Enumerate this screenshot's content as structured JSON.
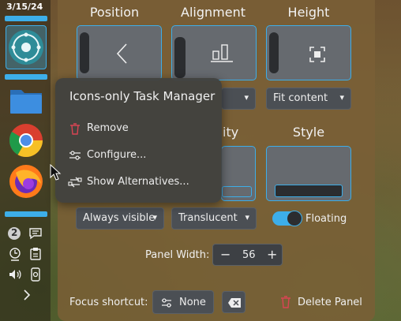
{
  "left_panel": {
    "date": "3/15/24",
    "notification_count": "2"
  },
  "config": {
    "position_title": "Position",
    "alignment_title": "Alignment",
    "height_title": "Height",
    "visibility_title_partial": "ity",
    "style_title": "Style",
    "height_dropdown": "Fit content",
    "visibility_dropdown": "Always visible",
    "opacity_dropdown": "Translucent",
    "floating_label": "Floating",
    "floating_on": true,
    "panel_width_label": "Panel Width:",
    "panel_width_value": "56",
    "focus_shortcut_label": "Focus shortcut:",
    "shortcut_value": "None",
    "delete_panel_label": "Delete Panel"
  },
  "context_menu": {
    "title": "Icons-only Task Manager",
    "items": [
      {
        "label": "Remove",
        "icon": "trash-icon"
      },
      {
        "label": "Configure...",
        "icon": "configure-icon"
      },
      {
        "label": "Show Alternatives...",
        "icon": "alternatives-icon"
      }
    ]
  },
  "colors": {
    "accent": "#3daee9",
    "danger": "#da4453",
    "panel_bg": "#7a5f36",
    "menu_bg": "#42423e"
  }
}
